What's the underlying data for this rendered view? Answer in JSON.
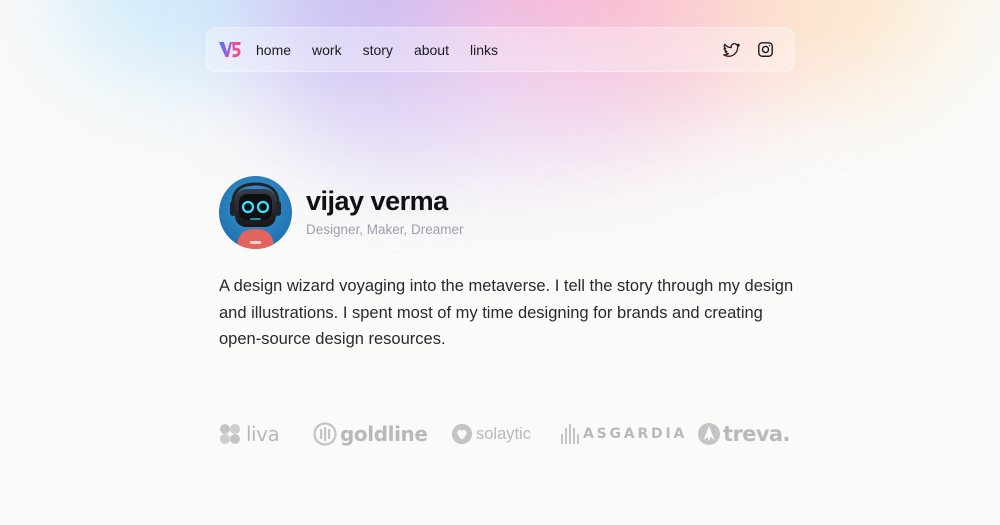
{
  "nav": {
    "logo_text": "V5",
    "links": [
      "home",
      "work",
      "story",
      "about",
      "links"
    ],
    "social": {
      "twitter_icon": "twitter-icon",
      "instagram_icon": "instagram-icon"
    }
  },
  "profile": {
    "name": "vijay verma",
    "tagline": "Designer, Maker, Dreamer",
    "avatar_icon": "robot-avatar"
  },
  "bio": "A design wizard voyaging into the metaverse. I tell the story through my design and illustrations. I spent most of my time designing for brands and creating open-source design resources.",
  "brands": [
    "liva",
    "goldline",
    "solaytic",
    "ASGARDIA",
    "treva."
  ],
  "colors": {
    "background": "#fafaf9",
    "text": "#1a1a1a",
    "tagline": "#9a9fae",
    "brand_logos": "#bdbdbd",
    "logo_blue": "#5b6cf0",
    "logo_pink": "#f04f8f"
  }
}
